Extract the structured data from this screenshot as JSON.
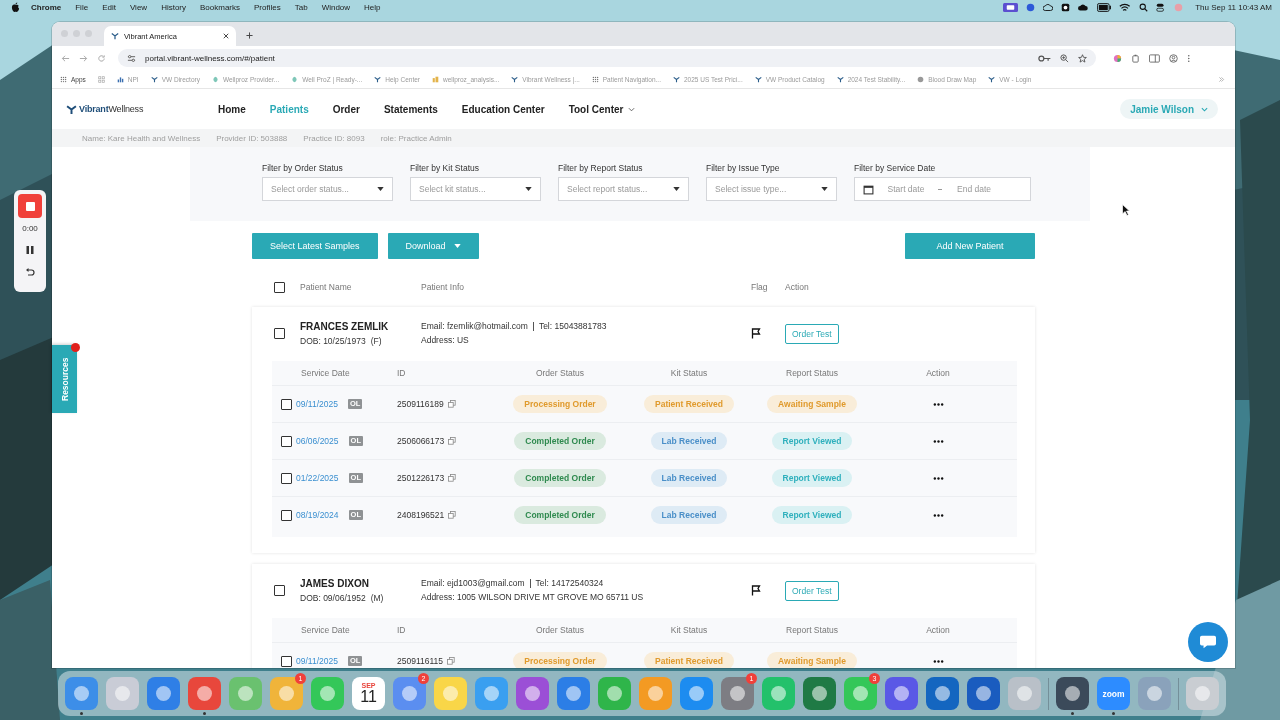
{
  "menu_bar": {
    "app": "Chrome",
    "items": [
      "File",
      "Edit",
      "View",
      "History",
      "Bookmarks",
      "Profiles",
      "Tab",
      "Window",
      "Help"
    ],
    "clock": "Thu Sep 11  10:43 AM"
  },
  "recorder": {
    "time": "0:00"
  },
  "browser": {
    "tab_title": "Vibrant America",
    "url": "portal.vibrant-wellness.com/#/patient",
    "bookmarks": [
      {
        "label": "Apps",
        "kind": "dots"
      },
      {
        "label": "NPI",
        "kind": "chart"
      },
      {
        "label": "VW Directory",
        "kind": "logo"
      },
      {
        "label": "Wellproz Provider...",
        "kind": "leaf"
      },
      {
        "label": "Well ProZ | Ready-...",
        "kind": "leaf"
      },
      {
        "label": "Help Center",
        "kind": "logo"
      },
      {
        "label": "wellproz_analysis...",
        "kind": "bars"
      },
      {
        "label": "Vibrant Wellness |...",
        "kind": "logo"
      },
      {
        "label": "Patient Navigation...",
        "kind": "dots"
      },
      {
        "label": "2025 US Test Prici...",
        "kind": "logo"
      },
      {
        "label": "VW Product Catalog",
        "kind": "logo"
      },
      {
        "label": "2024 Test Stability...",
        "kind": "logo"
      },
      {
        "label": "Blood Draw Map",
        "kind": "globe"
      },
      {
        "label": "VW - Login",
        "kind": "logo"
      }
    ]
  },
  "header": {
    "logo": "**Vibrant**Wellness",
    "nav": [
      {
        "label": "Home",
        "selected": false,
        "kind": "link"
      },
      {
        "label": "Patients",
        "selected": true,
        "kind": "link"
      },
      {
        "label": "Order",
        "selected": false,
        "kind": "link"
      },
      {
        "label": "Statements",
        "selected": false,
        "kind": "link"
      },
      {
        "label": "Education Center",
        "selected": false,
        "kind": "link"
      },
      {
        "label": "Tool Center",
        "selected": false,
        "kind": "menu"
      }
    ],
    "user": "Jamie Wilson"
  },
  "account_bar": [
    "Name: Kare Health and Wellness",
    "Provider ID: 503888",
    "Practice ID: 8093",
    "role: Practice Admin"
  ],
  "filters": [
    {
      "label": "Filter by Order Status",
      "placeholder": "Select order status...",
      "kind": "select"
    },
    {
      "label": "Filter by Kit Status",
      "placeholder": "Select kit status...",
      "kind": "select"
    },
    {
      "label": "Filter by Report Status",
      "placeholder": "Select report status...",
      "kind": "select"
    },
    {
      "label": "Filter by Issue Type",
      "placeholder": "Select issue type...",
      "kind": "select"
    },
    {
      "label": "Filter by Service Date",
      "placeholder": "Start date",
      "end_placeholder": "End date",
      "kind": "date"
    }
  ],
  "actions": {
    "select_latest": "Select Latest Samples",
    "download": "Download",
    "add_patient": "Add New Patient"
  },
  "table": {
    "columns": [
      "Patient Name",
      "Patient Info",
      "Flag",
      "Action"
    ],
    "all_checked": false,
    "patients": [
      {
        "name": "FRANCES ZEMLIK",
        "dob": "DOB: 10/25/1973",
        "sex": "(F)",
        "email": "Email: fzemlik@hotmail.com",
        "tel": "Tel: 15043881783",
        "address": "Address: US",
        "checked": false,
        "order_button": "Order Test",
        "sample_columns": [
          "Service Date",
          "ID",
          "Order Status",
          "Kit Status",
          "Report Status",
          "Action"
        ],
        "samples": [
          {
            "date": "09/11/2025",
            "tag": "OL",
            "id": "2509116189",
            "checked": false,
            "order_status": {
              "text": "Processing Order",
              "color": "#e09a2c"
            },
            "kit_status": {
              "text": "Patient Received",
              "color": "#e09a2c"
            },
            "report_status": {
              "text": "Awaiting Sample",
              "color": "#e09a2c"
            }
          },
          {
            "date": "06/06/2025",
            "tag": "OL",
            "id": "2506066173",
            "checked": false,
            "order_status": {
              "text": "Completed Order",
              "color": "#2f8a4f"
            },
            "kit_status": {
              "text": "Lab Received",
              "color": "#4a8fc8"
            },
            "report_status": {
              "text": "Report Viewed",
              "color": "#2fb0bd"
            }
          },
          {
            "date": "01/22/2025",
            "tag": "OL",
            "id": "2501226173",
            "checked": false,
            "order_status": {
              "text": "Completed Order",
              "color": "#2f8a4f"
            },
            "kit_status": {
              "text": "Lab Received",
              "color": "#4a8fc8"
            },
            "report_status": {
              "text": "Report Viewed",
              "color": "#2fb0bd"
            }
          },
          {
            "date": "08/19/2024",
            "tag": "OL",
            "id": "2408196521",
            "checked": false,
            "order_status": {
              "text": "Completed Order",
              "color": "#2f8a4f"
            },
            "kit_status": {
              "text": "Lab Received",
              "color": "#4a8fc8"
            },
            "report_status": {
              "text": "Report Viewed",
              "color": "#2fb0bd"
            }
          }
        ]
      },
      {
        "name": "JAMES DIXON",
        "dob": "DOB: 09/06/1952",
        "sex": "(M)",
        "email": "Email: ejd1003@gmail.com",
        "tel": "Tel: 14172540324",
        "address": "Address: 1005 WILSON DRIVE MT GROVE MO 65711 US",
        "checked": false,
        "order_button": "Order Test",
        "sample_columns": [
          "Service Date",
          "ID",
          "Order Status",
          "Kit Status",
          "Report Status",
          "Action"
        ],
        "samples": [
          {
            "date": "09/11/2025",
            "tag": "OL",
            "id": "2509116115",
            "checked": false,
            "order_status": {
              "text": "Processing Order",
              "color": "#e09a2c"
            },
            "kit_status": {
              "text": "Patient Received",
              "color": "#e09a2c"
            },
            "report_status": {
              "text": "Awaiting Sample",
              "color": "#e09a2c"
            }
          }
        ]
      }
    ]
  },
  "side_tab": "Resources",
  "dock": {
    "groups": [
      {
        "apps": [
          {
            "kind": "app",
            "color": "#3d8ee8",
            "running": true
          },
          {
            "kind": "app",
            "color": "#c9ccd6",
            "running": false
          },
          {
            "kind": "app",
            "color": "#2f7fe6",
            "running": false
          },
          {
            "kind": "app",
            "color": "#e8473c",
            "running": true
          },
          {
            "kind": "app",
            "color": "#6ac16f",
            "running": false
          },
          {
            "kind": "app",
            "color": "#f0b43a",
            "running": false,
            "badge": "1"
          },
          {
            "kind": "app",
            "color": "#34c759",
            "running": false
          },
          {
            "kind": "calendar",
            "color": "#e8453c",
            "month": "SEP",
            "day": "11",
            "running": false
          },
          {
            "kind": "app",
            "color": "#5b8ef0",
            "running": false,
            "badge": "2"
          },
          {
            "kind": "app",
            "color": "#f9d648",
            "running": false
          },
          {
            "kind": "app",
            "color": "#3a9ff0",
            "running": false
          },
          {
            "kind": "app",
            "color": "#9b4fd6",
            "running": false
          },
          {
            "kind": "app",
            "color": "#2c7ee6",
            "running": false
          },
          {
            "kind": "app",
            "color": "#2fb54a",
            "running": false
          },
          {
            "kind": "app",
            "color": "#f39a23",
            "running": false
          },
          {
            "kind": "app",
            "color": "#1d8cf0",
            "running": false
          },
          {
            "kind": "app",
            "color": "#7d7d83",
            "running": false,
            "badge": "1"
          },
          {
            "kind": "app",
            "color": "#23c16b",
            "running": false
          },
          {
            "kind": "app",
            "color": "#1f7a45",
            "running": false
          },
          {
            "kind": "app",
            "color": "#34c759",
            "running": false,
            "badge": "3"
          },
          {
            "kind": "app",
            "color": "#5a58e6",
            "running": false
          },
          {
            "kind": "app",
            "color": "#1466c0",
            "running": false
          },
          {
            "kind": "app",
            "color": "#1a5cbf",
            "running": false
          },
          {
            "kind": "app",
            "color": "#b9c0c8",
            "running": false
          }
        ]
      },
      {
        "apps": [
          {
            "kind": "app",
            "color": "#3b4a5a",
            "running": true
          },
          {
            "kind": "labelled",
            "color": "#2d8cff",
            "label": "zoom",
            "running": true
          },
          {
            "kind": "app",
            "color": "#8aa2bb",
            "running": false
          }
        ]
      },
      {
        "apps": [
          {
            "kind": "app",
            "color": "#c9cdd2",
            "running": false
          }
        ]
      }
    ]
  }
}
